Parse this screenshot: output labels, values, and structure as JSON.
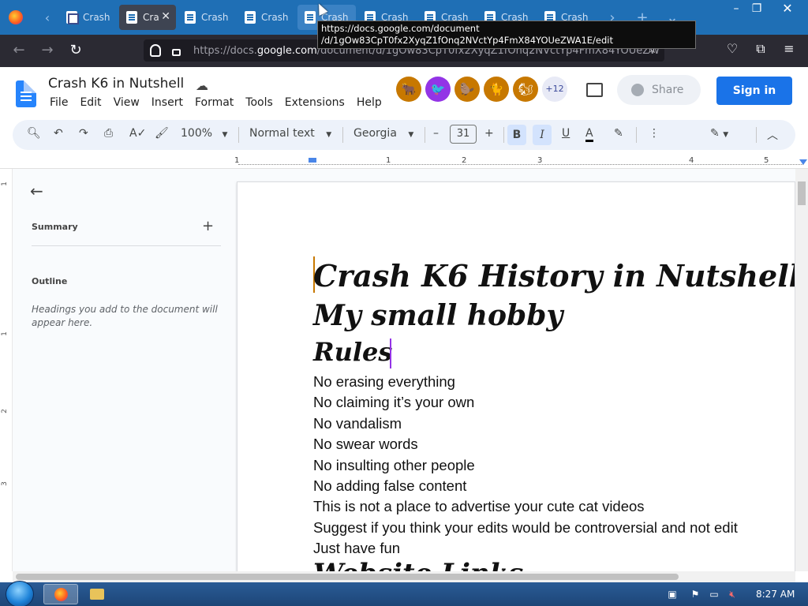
{
  "browser": {
    "tabs": [
      {
        "label": "Crash",
        "type": "forms"
      },
      {
        "label": "Cra",
        "type": "docs",
        "active": true
      },
      {
        "label": "Crash",
        "type": "docs"
      },
      {
        "label": "Crash",
        "type": "docs"
      },
      {
        "label": "Crash",
        "type": "docs",
        "hover": true
      },
      {
        "label": "Crash",
        "type": "docs"
      },
      {
        "label": "Crash",
        "type": "docs"
      },
      {
        "label": "Crash",
        "type": "docs"
      },
      {
        "label": "Crash",
        "type": "docs"
      }
    ],
    "tooltip_line1": "https://docs.google.com/document",
    "tooltip_line2": "/d/1gOw83CpT0fx2XyqZ1fOnq2NVctYp4FmX84YOUeZWA1E/edit",
    "url_prefix": "https://docs.",
    "url_host": "google.com",
    "url_rest": "/document/d/1gOw83CpT0fx2XyqZ1fOnq2NVctYp4FmX84YOUeZW"
  },
  "docs": {
    "title": "Crash K6 in Nutshell",
    "menu": [
      "File",
      "Edit",
      "View",
      "Insert",
      "Format",
      "Tools",
      "Extensions",
      "Help"
    ],
    "avatars": [
      {
        "glyph": "🐂",
        "color": "#c77800"
      },
      {
        "glyph": "🐦",
        "color": "#9334e6"
      },
      {
        "glyph": "🦫",
        "color": "#c77800"
      },
      {
        "glyph": "🐈",
        "color": "#c77800"
      },
      {
        "glyph": "🐿",
        "color": "#c77800"
      }
    ],
    "avatar_more": "+12",
    "share_label": "Share",
    "signin_label": "Sign in",
    "accent_color": "#1a73e8"
  },
  "toolbar": {
    "zoom": "100%",
    "style": "Normal text",
    "font": "Georgia",
    "font_size": "31"
  },
  "ruler": [
    "1",
    "1",
    "2",
    "3",
    "4",
    "5",
    "6"
  ],
  "vruler": [
    "1",
    "1",
    "2",
    "3"
  ],
  "outline_panel": {
    "summary_label": "Summary",
    "outline_label": "Outline",
    "hint": "Headings you add to the document will appear here."
  },
  "document": {
    "headings": [
      "Crash K6 History in Nutshell",
      "My small hobby",
      "Rules"
    ],
    "lines": [
      "No erasing everything",
      "No claiming it’s your own",
      "No vandalism",
      "No swear words",
      "No insulting other people",
      "No adding false content",
      "This is not a place to advertise your cute cat videos",
      "Suggest if you think your edits would be controversial and not edit",
      "Just have fun"
    ],
    "partial_heading": "Website Links"
  },
  "taskbar": {
    "clock": "8:27 AM"
  }
}
